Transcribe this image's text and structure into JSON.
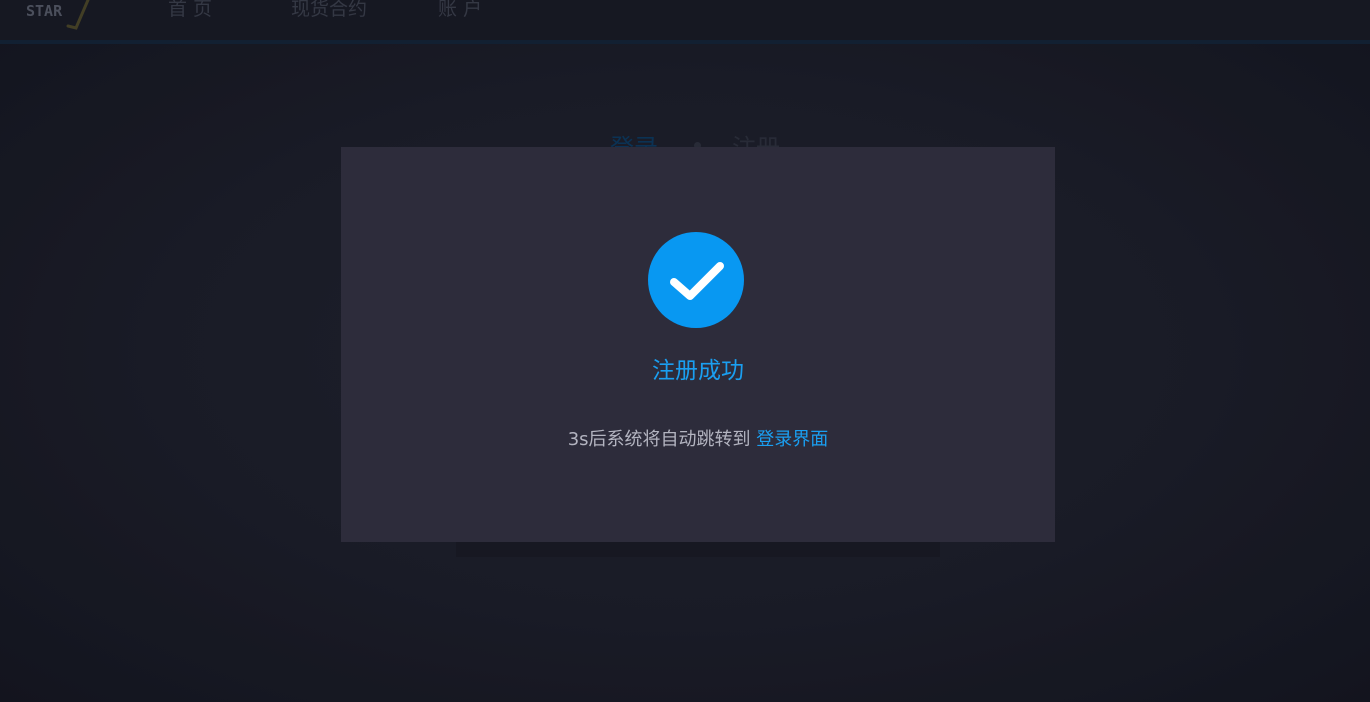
{
  "header": {
    "logo_text": "STAR",
    "nav": [
      {
        "label": "首 页"
      },
      {
        "label": "现货合约"
      },
      {
        "label": "账 户"
      }
    ]
  },
  "background_form": {
    "tabs": [
      {
        "label": "登录",
        "active": true
      },
      {
        "label": "注册",
        "active": false
      }
    ]
  },
  "modal": {
    "icon": "check-circle-icon",
    "title": "注册成功",
    "message": "3s后系统将自动跳转到",
    "link_label": "登录界面"
  },
  "colors": {
    "accent": "#0898f2",
    "modal_bg": "#2d2c3b",
    "page_bg": "#1d1f2b"
  }
}
